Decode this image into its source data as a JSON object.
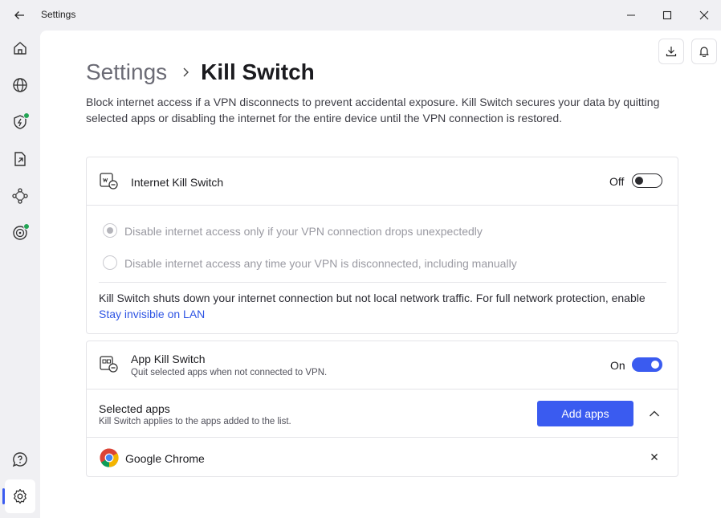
{
  "window": {
    "title": "Settings",
    "back_icon": "arrow-left-icon",
    "minimize_icon": "minimize-icon",
    "maximize_icon": "maximize-icon",
    "close_icon": "close-icon"
  },
  "sidebar": {
    "items": [
      {
        "name": "home",
        "icon": "home-icon"
      },
      {
        "name": "globe",
        "icon": "globe-icon"
      },
      {
        "name": "threat-protection",
        "icon": "shield-bolt-icon",
        "badge": true
      },
      {
        "name": "file-share",
        "icon": "file-share-icon"
      },
      {
        "name": "meshnet",
        "icon": "mesh-icon"
      },
      {
        "name": "dark-web-monitor",
        "icon": "radar-icon",
        "badge": true
      },
      {
        "name": "help",
        "icon": "help-chat-icon"
      },
      {
        "name": "settings",
        "icon": "gear-icon",
        "active": true
      }
    ],
    "badge_color": "#23a454",
    "accent": "#3a5bf0"
  },
  "header": {
    "breadcrumb_root": "Settings",
    "breadcrumb_current": "Kill Switch",
    "download_icon": "download-icon",
    "bell_icon": "bell-icon",
    "description": "Block internet access if a VPN disconnects to prevent accidental exposure. Kill Switch secures your data by quitting selected apps or disabling the internet for the entire device until the VPN connection is restored."
  },
  "internet_kill_switch": {
    "title": "Internet Kill Switch",
    "state_label": "Off",
    "enabled": false,
    "options": [
      {
        "label": "Disable internet access only if your VPN connection drops unexpectedly",
        "selected": true
      },
      {
        "label": "Disable internet access any time your VPN is disconnected, including manually",
        "selected": false
      }
    ],
    "note": "Kill Switch shuts down your internet connection but not local network traffic. For full network protection, enable",
    "note_link": "Stay invisible on LAN"
  },
  "app_kill_switch": {
    "title": "App Kill Switch",
    "subtitle": "Quit selected apps when not connected to VPN.",
    "state_label": "On",
    "enabled": true,
    "selected_apps_title": "Selected apps",
    "selected_apps_subtitle": "Kill Switch applies to the apps added to the list.",
    "add_button": "Add apps",
    "apps": [
      {
        "name": "Google Chrome",
        "icon": "chrome-icon"
      }
    ]
  },
  "colors": {
    "accent": "#3a5bf0",
    "link": "#2f55e4"
  }
}
